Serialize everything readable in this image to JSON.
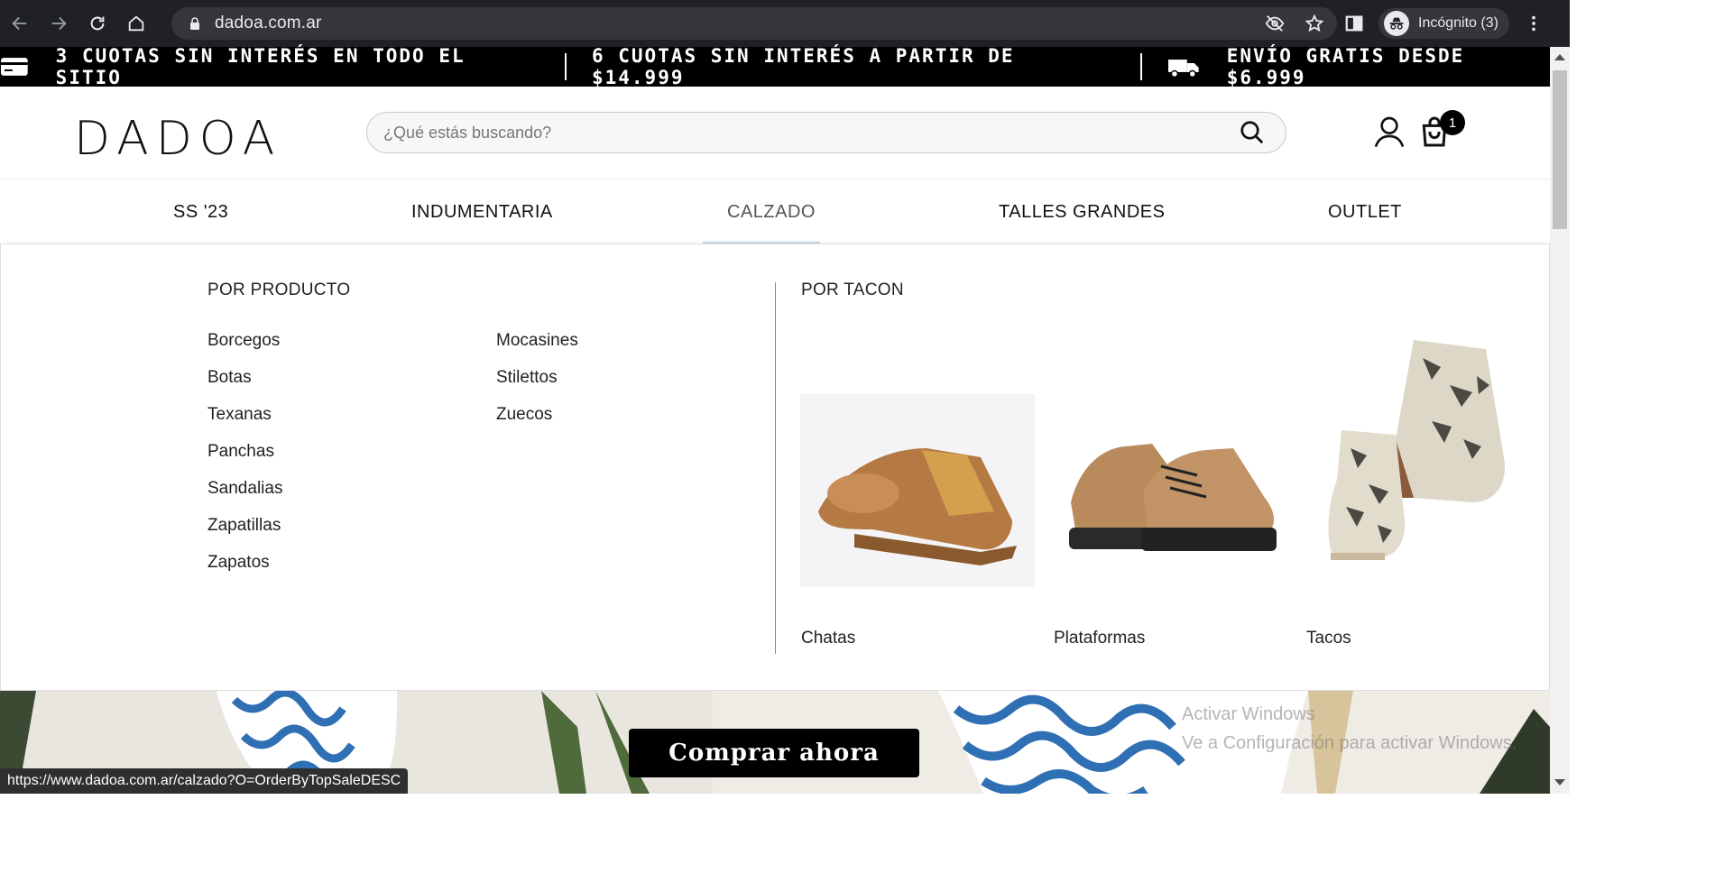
{
  "browser": {
    "url": "dadoa.com.ar",
    "profile_label": "Incógnito (3)",
    "status_url": "https://www.dadoa.com.ar/calzado?O=OrderByTopSaleDESC"
  },
  "promo": {
    "items": [
      "3 CUOTAS SIN INTERÉS EN TODO EL SITIO",
      "6 CUOTAS SIN INTERÉS A PARTIR DE $14.999",
      "ENVÍO GRATIS DESDE $6.999"
    ]
  },
  "header": {
    "logo": "DADOA",
    "search_placeholder": "¿Qué estás buscando?",
    "cart_count": "1"
  },
  "nav": {
    "tabs": [
      "SS '23",
      "INDUMENTARIA",
      "CALZADO",
      "TALLES GRANDES",
      "OUTLET"
    ],
    "active": "CALZADO"
  },
  "dropdown": {
    "by_product_title": "POR PRODUCTO",
    "by_product_col1": [
      "Borcegos",
      "Botas",
      "Texanas",
      "Panchas",
      "Sandalias",
      "Zapatillas",
      "Zapatos"
    ],
    "by_product_col2": [
      "Mocasines",
      "Stilettos",
      "Zuecos"
    ],
    "by_heel_title": "POR TACON",
    "by_heel_items": [
      "Chatas",
      "Plataformas",
      "Tacos"
    ]
  },
  "hero": {
    "cta": "Comprar ahora",
    "watermark_line1": "Activar Windows",
    "watermark_line2": "Ve a Configuración para activar Windows."
  },
  "colors": {
    "promo_bg": "#000000",
    "browser_bg": "#202124",
    "nav_underline": "#c9dbe6"
  }
}
